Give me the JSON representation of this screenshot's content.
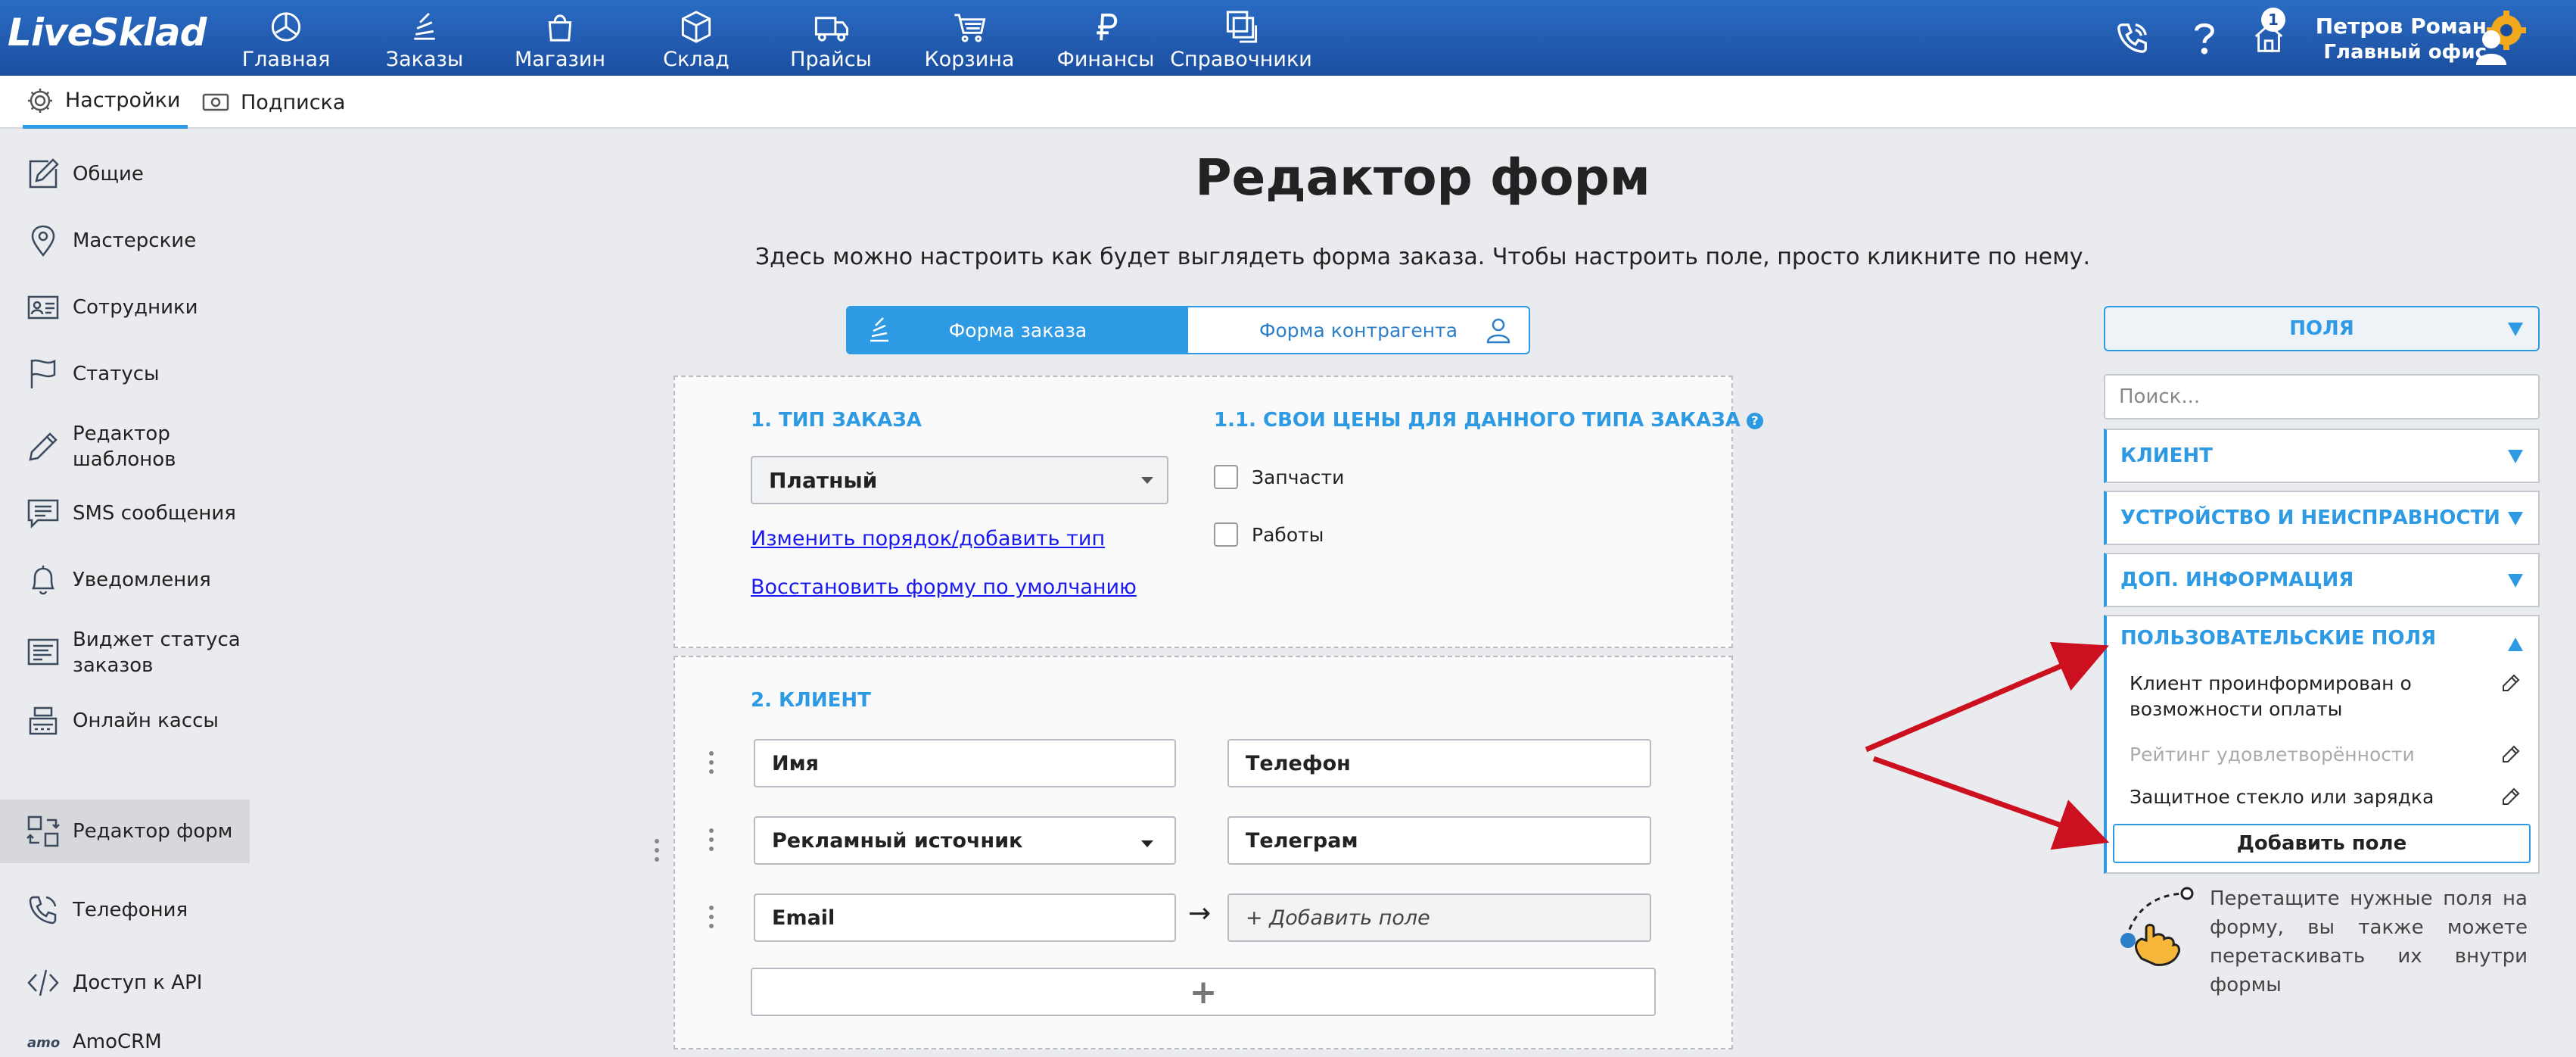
{
  "app": {
    "logo": "LiveSklad",
    "nav": [
      {
        "label": "Главная",
        "icon": "dashboard-icon"
      },
      {
        "label": "Заказы",
        "icon": "orders-icon"
      },
      {
        "label": "Магазин",
        "icon": "shop-bag-icon"
      },
      {
        "label": "Склад",
        "icon": "warehouse-box-icon"
      },
      {
        "label": "Прайсы",
        "icon": "truck-icon"
      },
      {
        "label": "Корзина",
        "icon": "cart-icon"
      },
      {
        "label": "Финансы",
        "icon": "ruble-icon"
      },
      {
        "label": "Справочники",
        "icon": "directories-icon"
      }
    ],
    "notifications_count": "1",
    "user": {
      "name": "Петров Роман",
      "office": "Главный офис"
    },
    "colors": {
      "header": "#1b4e9f",
      "accent": "#2d9ae3",
      "annotation_arrow": "#cc1020"
    }
  },
  "subnav": {
    "settings": "Настройки",
    "subscription": "Подписка"
  },
  "sidebar": {
    "items": [
      {
        "label": "Общие",
        "icon": "edit-icon"
      },
      {
        "label": "Мастерские",
        "icon": "location-pin-icon"
      },
      {
        "label": "Сотрудники",
        "icon": "id-card-icon"
      },
      {
        "label": "Статусы",
        "icon": "flag-icon"
      },
      {
        "label": "Редактор шаблонов",
        "icon": "pen-icon"
      },
      {
        "label": "SMS сообщения",
        "icon": "chat-icon"
      },
      {
        "label": "Уведомления",
        "icon": "bell-icon"
      },
      {
        "label": "Виджет статуса заказов",
        "icon": "widget-icon"
      },
      {
        "label": "Онлайн кассы",
        "icon": "cash-register-icon"
      },
      {
        "label": "Редактор форм",
        "icon": "form-editor-icon",
        "active": true
      },
      {
        "label": "Телефония",
        "icon": "phone-icon"
      },
      {
        "label": "Доступ к API",
        "icon": "code-icon"
      },
      {
        "label": "AmoCRM",
        "icon": "amocrm-icon"
      }
    ]
  },
  "main": {
    "title": "Редактор форм",
    "description": "Здесь можно настроить как будет выглядеть форма заказа. Чтобы настроить поле, просто кликните по нему.",
    "tabs": {
      "order_form": "Форма заказа",
      "contractor_form": "Форма контрагента"
    },
    "section1": {
      "title": "1. ТИП ЗАКАЗА",
      "order_type_value": "Платный",
      "link_change_order": "Изменить порядок/добавить тип",
      "link_restore": "Восстановить форму по умолчанию"
    },
    "section11": {
      "title": "1.1. СВОИ ЦЕНЫ ДЛЯ ДАННОГО ТИПА ЗАКАЗА",
      "help": "?",
      "checkbox_parts": "Запчасти",
      "checkbox_works": "Работы"
    },
    "section2": {
      "title": "2. КЛИЕНТ",
      "fields": {
        "name": "Имя",
        "phone": "Телефон",
        "ad_source": "Рекламный источник",
        "telegram": "Телеграм",
        "email": "Email",
        "add_field_placeholder": "+ Добавить поле"
      },
      "arrow": "→",
      "add_row": "+"
    }
  },
  "right_panel": {
    "fields_header": "ПОЛЯ",
    "search_placeholder": "Поиск...",
    "groups": {
      "client": "КЛИЕНТ",
      "device": "УСТРОЙСТВО И НЕИСПРАВНОСТИ",
      "extra": "ДОП. ИНФОРМАЦИЯ",
      "custom": "ПОЛЬЗОВАТЕЛЬСКИЕ ПОЛЯ"
    },
    "custom_fields": [
      {
        "label": "Клиент проинформирован о возможности оплаты"
      },
      {
        "label": "Рейтинг удовлетворённости",
        "muted": true
      },
      {
        "label": "Защитное стекло или зарядка"
      }
    ],
    "add_field_button": "Добавить поле",
    "hint": "Перетащите нужные поля на форму, вы также можете перетаскивать их внутри формы"
  }
}
